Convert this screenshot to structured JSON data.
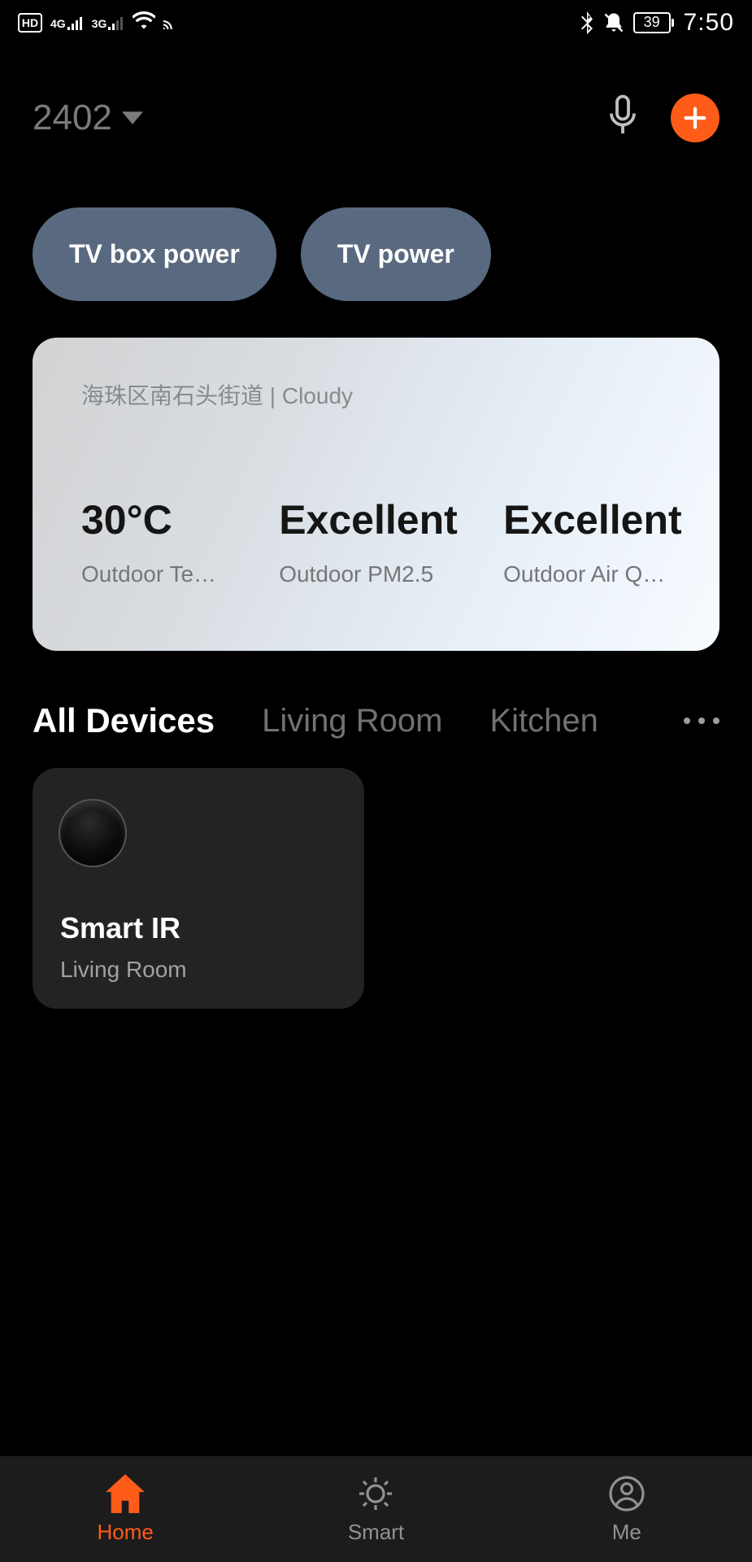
{
  "status_bar": {
    "hd_label": "HD",
    "net1_label": "4G",
    "net2_label": "3G",
    "battery_pct": "39",
    "time": "7:50"
  },
  "header": {
    "home_name": "2402"
  },
  "scenes": [
    {
      "label": "TV box power"
    },
    {
      "label": "TV power"
    }
  ],
  "weather": {
    "location": "海珠区南石头街道",
    "separator": "  |  ",
    "condition": "Cloudy",
    "metrics": [
      {
        "value": "30°C",
        "label": "Outdoor Temp."
      },
      {
        "value": "Excellent",
        "label": "Outdoor PM2.5"
      },
      {
        "value": "Excellent",
        "label": "Outdoor Air Qu…"
      }
    ]
  },
  "room_tabs": {
    "items": [
      "All Devices",
      "Living Room",
      "Kitchen"
    ],
    "active_index": 0
  },
  "devices": [
    {
      "name": "Smart IR",
      "room": "Living Room"
    }
  ],
  "bottom_nav": {
    "items": [
      {
        "label": "Home",
        "icon": "home"
      },
      {
        "label": "Smart",
        "icon": "sun"
      },
      {
        "label": "Me",
        "icon": "person"
      }
    ],
    "active_index": 0
  },
  "colors": {
    "accent": "#ff5c1a",
    "chip_bg": "#59697f",
    "card_bg": "#232323",
    "nav_bg": "#1c1c1c"
  }
}
